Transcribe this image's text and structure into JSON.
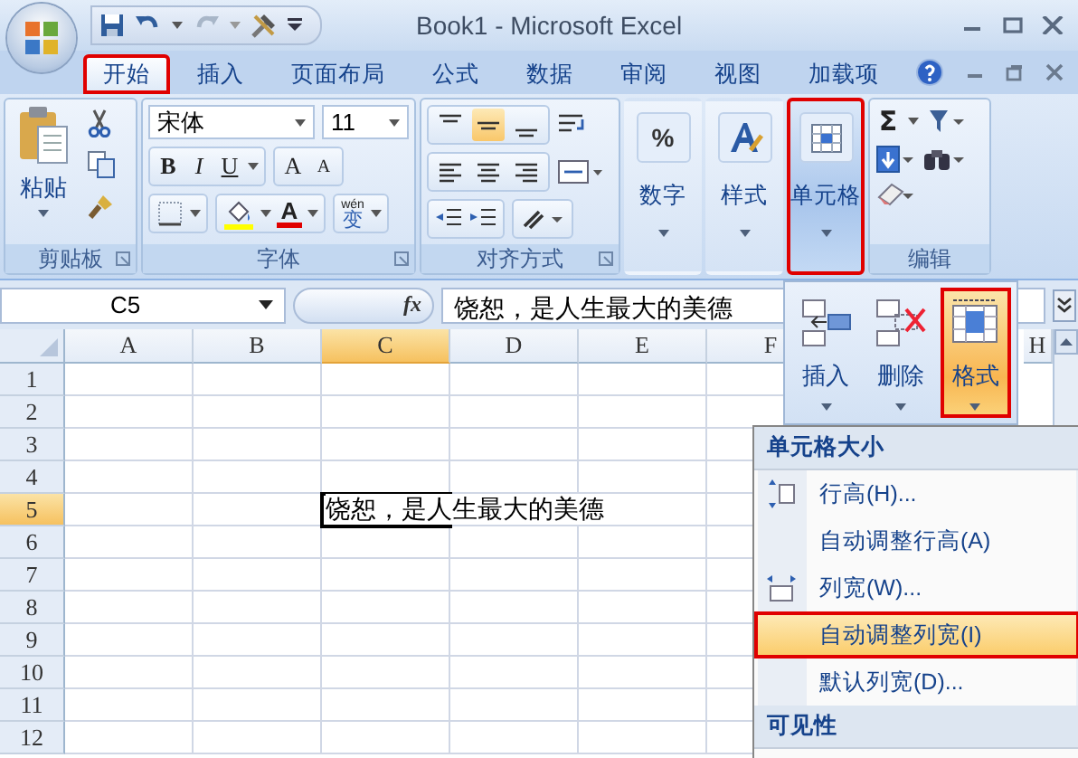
{
  "window": {
    "title": "Book1 - Microsoft Excel"
  },
  "tabs": [
    {
      "label": "开始",
      "selected": true,
      "annotated": true
    },
    {
      "label": "插入",
      "selected": false,
      "annotated": false
    },
    {
      "label": "页面布局",
      "selected": false,
      "annotated": false
    },
    {
      "label": "公式",
      "selected": false,
      "annotated": false
    },
    {
      "label": "数据",
      "selected": false,
      "annotated": false
    },
    {
      "label": "审阅",
      "selected": false,
      "annotated": false
    },
    {
      "label": "视图",
      "selected": false,
      "annotated": false
    },
    {
      "label": "加载项",
      "selected": false,
      "annotated": false
    }
  ],
  "ribbon": {
    "groups": [
      {
        "kind": "clipboard",
        "label": "剪贴板",
        "button": "粘贴"
      },
      {
        "kind": "font",
        "label": "字体",
        "font_name": "宋体",
        "font_size": "11",
        "bold": "B",
        "italic": "I",
        "underline": "U",
        "grow": "A",
        "shrink": "A",
        "font_color": "A",
        "phonetic": "变",
        "phonetic_top": "wén"
      },
      {
        "kind": "alignment",
        "label": "对齐方式",
        "valign": [
          {
            "selected": false
          },
          {
            "selected": true
          },
          {
            "selected": false
          }
        ]
      },
      {
        "kind": "number",
        "label": "数字",
        "glyph": "%",
        "selected": false,
        "annotated": false
      },
      {
        "kind": "styles",
        "label": "样式",
        "selected": false,
        "annotated": false
      },
      {
        "kind": "cells",
        "label": "单元格",
        "selected": true,
        "annotated": true
      },
      {
        "kind": "editing",
        "label": "编辑",
        "sum": "Σ"
      }
    ]
  },
  "formula_bar": {
    "name_box": "C5",
    "fx": "fx",
    "content": "饶恕，是人生最大的美德"
  },
  "sheet": {
    "columns": [
      {
        "label": "A",
        "selected": false
      },
      {
        "label": "B",
        "selected": false
      },
      {
        "label": "C",
        "selected": true
      },
      {
        "label": "D",
        "selected": false
      },
      {
        "label": "E",
        "selected": false
      },
      {
        "label": "F",
        "selected": false
      },
      {
        "label": "H",
        "selected": false
      }
    ],
    "rows": [
      {
        "label": "1",
        "selected": false,
        "cells": [
          {
            "selected": false
          },
          {
            "selected": false
          },
          {
            "selected": false
          },
          {
            "selected": false
          },
          {
            "selected": false
          },
          {
            "selected": false
          }
        ]
      },
      {
        "label": "2",
        "selected": false,
        "cells": [
          {
            "selected": false
          },
          {
            "selected": false
          },
          {
            "selected": false
          },
          {
            "selected": false
          },
          {
            "selected": false
          },
          {
            "selected": false
          }
        ]
      },
      {
        "label": "3",
        "selected": false,
        "cells": [
          {
            "selected": false
          },
          {
            "selected": false
          },
          {
            "selected": false
          },
          {
            "selected": false
          },
          {
            "selected": false
          },
          {
            "selected": false
          }
        ]
      },
      {
        "label": "4",
        "selected": false,
        "cells": [
          {
            "selected": false
          },
          {
            "selected": false
          },
          {
            "selected": false
          },
          {
            "selected": false
          },
          {
            "selected": false
          },
          {
            "selected": false
          }
        ]
      },
      {
        "label": "5",
        "selected": true,
        "cells": [
          {
            "selected": false
          },
          {
            "selected": false
          },
          {
            "selected": true,
            "text": "饶恕，是人生最大的美德"
          },
          {
            "selected": false
          },
          {
            "selected": false
          },
          {
            "selected": false
          }
        ]
      },
      {
        "label": "6",
        "selected": false,
        "cells": [
          {
            "selected": false
          },
          {
            "selected": false
          },
          {
            "selected": false
          },
          {
            "selected": false
          },
          {
            "selected": false
          },
          {
            "selected": false
          }
        ]
      },
      {
        "label": "7",
        "selected": false,
        "cells": [
          {
            "selected": false
          },
          {
            "selected": false
          },
          {
            "selected": false
          },
          {
            "selected": false
          },
          {
            "selected": false
          },
          {
            "selected": false
          }
        ]
      },
      {
        "label": "8",
        "selected": false,
        "cells": [
          {
            "selected": false
          },
          {
            "selected": false
          },
          {
            "selected": false
          },
          {
            "selected": false
          },
          {
            "selected": false
          },
          {
            "selected": false
          }
        ]
      },
      {
        "label": "9",
        "selected": false,
        "cells": [
          {
            "selected": false
          },
          {
            "selected": false
          },
          {
            "selected": false
          },
          {
            "selected": false
          },
          {
            "selected": false
          },
          {
            "selected": false
          }
        ]
      },
      {
        "label": "10",
        "selected": false,
        "cells": [
          {
            "selected": false
          },
          {
            "selected": false
          },
          {
            "selected": false
          },
          {
            "selected": false
          },
          {
            "selected": false
          },
          {
            "selected": false
          }
        ]
      },
      {
        "label": "11",
        "selected": false,
        "cells": [
          {
            "selected": false
          },
          {
            "selected": false
          },
          {
            "selected": false
          },
          {
            "selected": false
          },
          {
            "selected": false
          },
          {
            "selected": false
          }
        ]
      },
      {
        "label": "12",
        "selected": false,
        "cells": [
          {
            "selected": false
          },
          {
            "selected": false
          },
          {
            "selected": false
          },
          {
            "selected": false
          },
          {
            "selected": false
          },
          {
            "selected": false
          }
        ]
      }
    ]
  },
  "cells_popup": {
    "buttons": [
      {
        "label": "插入",
        "kind": "insert",
        "selected": false,
        "annotated": false
      },
      {
        "label": "删除",
        "kind": "delete",
        "selected": false,
        "annotated": false
      },
      {
        "label": "格式",
        "kind": "format",
        "selected": true,
        "annotated": true
      }
    ]
  },
  "format_menu": {
    "sections": [
      {
        "heading": "单元格大小",
        "items": [
          {
            "label": "行高(H)...",
            "kind": "row-height",
            "selected": false,
            "annotated": false
          },
          {
            "label": "自动调整行高(A)",
            "kind": "plain",
            "selected": false,
            "annotated": false
          },
          {
            "label": "列宽(W)...",
            "kind": "column-width",
            "selected": false,
            "annotated": false
          },
          {
            "label": "自动调整列宽(I)",
            "kind": "plain",
            "selected": true,
            "annotated": true
          },
          {
            "label": "默认列宽(D)...",
            "kind": "plain",
            "selected": false,
            "annotated": false
          }
        ]
      },
      {
        "heading": "可见性"
      }
    ]
  }
}
